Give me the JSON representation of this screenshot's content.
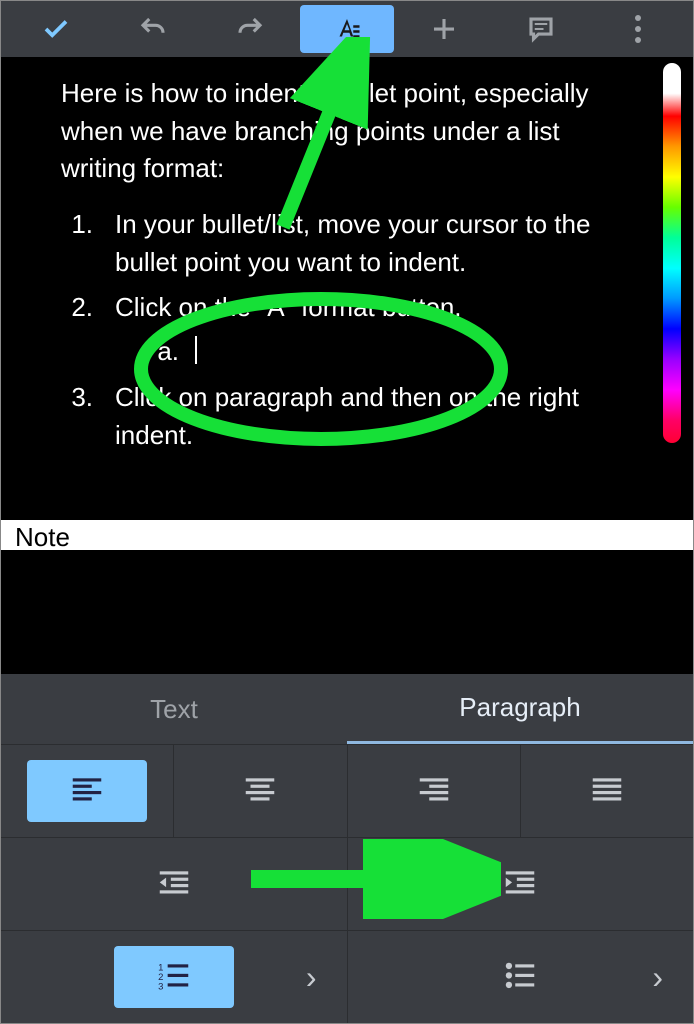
{
  "toolbar": {
    "confirm": "confirm",
    "undo": "undo",
    "redo": "redo",
    "format": "format",
    "insert": "insert",
    "comment": "comment",
    "overflow": "more"
  },
  "doc": {
    "intro": "Here is how to indent a bullet point, especially when we have branching points under a list writing format:",
    "items": [
      {
        "num": "1.",
        "text": "In your bullet/list, move your cursor to the bullet point you want to indent."
      },
      {
        "num": "2.",
        "text": "Click on the \"A\" format button.",
        "sub": {
          "letter": "a."
        }
      },
      {
        "num": "3.",
        "text": "Click on paragraph and then on the right indent."
      }
    ]
  },
  "notebar": "Note",
  "panel": {
    "tabs": {
      "text": "Text",
      "paragraph": "Paragraph",
      "active": "paragraph"
    },
    "align": [
      "left",
      "center",
      "right",
      "justify"
    ],
    "indent": [
      "decrease",
      "increase"
    ],
    "lists": [
      "numbered",
      "bulleted"
    ]
  }
}
